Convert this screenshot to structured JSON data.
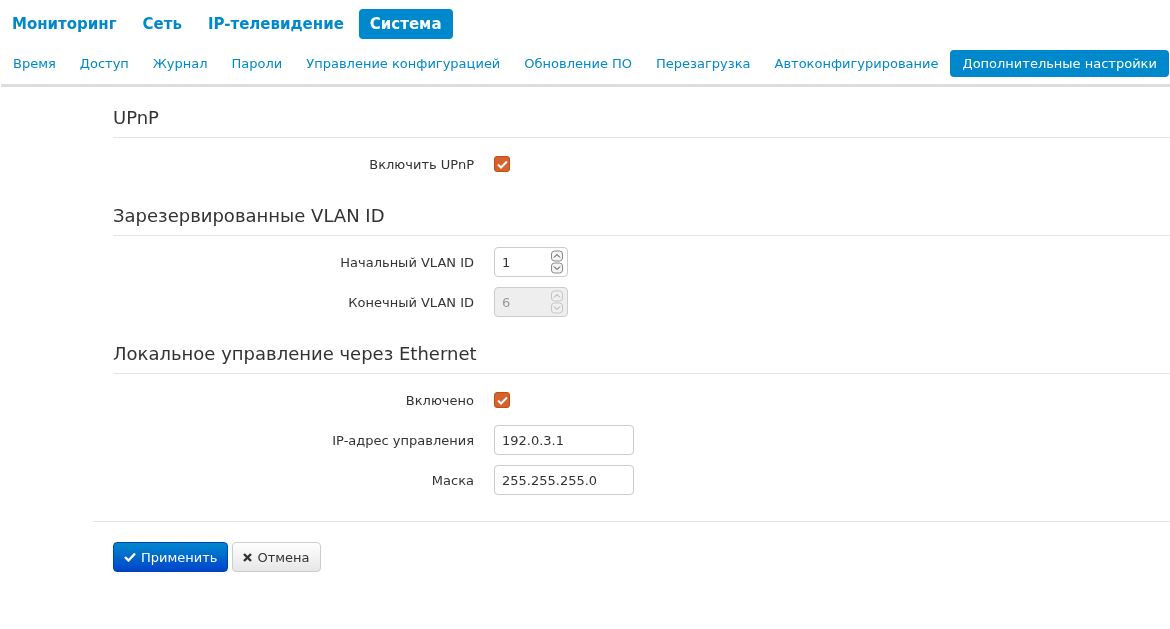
{
  "main_nav": [
    {
      "label": "Мониторинг",
      "selected": false
    },
    {
      "label": "Сеть",
      "selected": false
    },
    {
      "label": "IP-телевидение",
      "selected": false
    },
    {
      "label": "Система",
      "selected": true
    }
  ],
  "sub_nav": [
    {
      "label": "Время",
      "selected": false
    },
    {
      "label": "Доступ",
      "selected": false
    },
    {
      "label": "Журнал",
      "selected": false
    },
    {
      "label": "Пароли",
      "selected": false
    },
    {
      "label": "Управление конфигурацией",
      "selected": false
    },
    {
      "label": "Обновление ПО",
      "selected": false
    },
    {
      "label": "Перезагрузка",
      "selected": false
    },
    {
      "label": "Автоконфигурирование",
      "selected": false
    },
    {
      "label": "Дополнительные настройки",
      "selected": true
    }
  ],
  "sections": [
    {
      "title": "UPnP",
      "fields": [
        {
          "kind": "checkbox",
          "label": "Включить UPnP",
          "checked": true
        }
      ]
    },
    {
      "title": "Зарезервированные VLAN ID",
      "fields": [
        {
          "kind": "spinner",
          "label": "Начальный VLAN ID",
          "value": "1",
          "disabled": false
        },
        {
          "kind": "spinner",
          "label": "Конечный VLAN ID",
          "value": "6",
          "disabled": true
        }
      ]
    },
    {
      "title": "Локальное управление через Ethernet",
      "fields": [
        {
          "kind": "checkbox",
          "label": "Включено",
          "checked": true
        },
        {
          "kind": "text",
          "label": "IP-адрес управления",
          "value": "192.0.3.1"
        },
        {
          "kind": "text",
          "label": "Маска",
          "value": "255.255.255.0"
        }
      ]
    }
  ],
  "buttons": [
    {
      "kind": "primary",
      "label": "Применить"
    },
    {
      "kind": "default",
      "label": "Отмена"
    }
  ]
}
